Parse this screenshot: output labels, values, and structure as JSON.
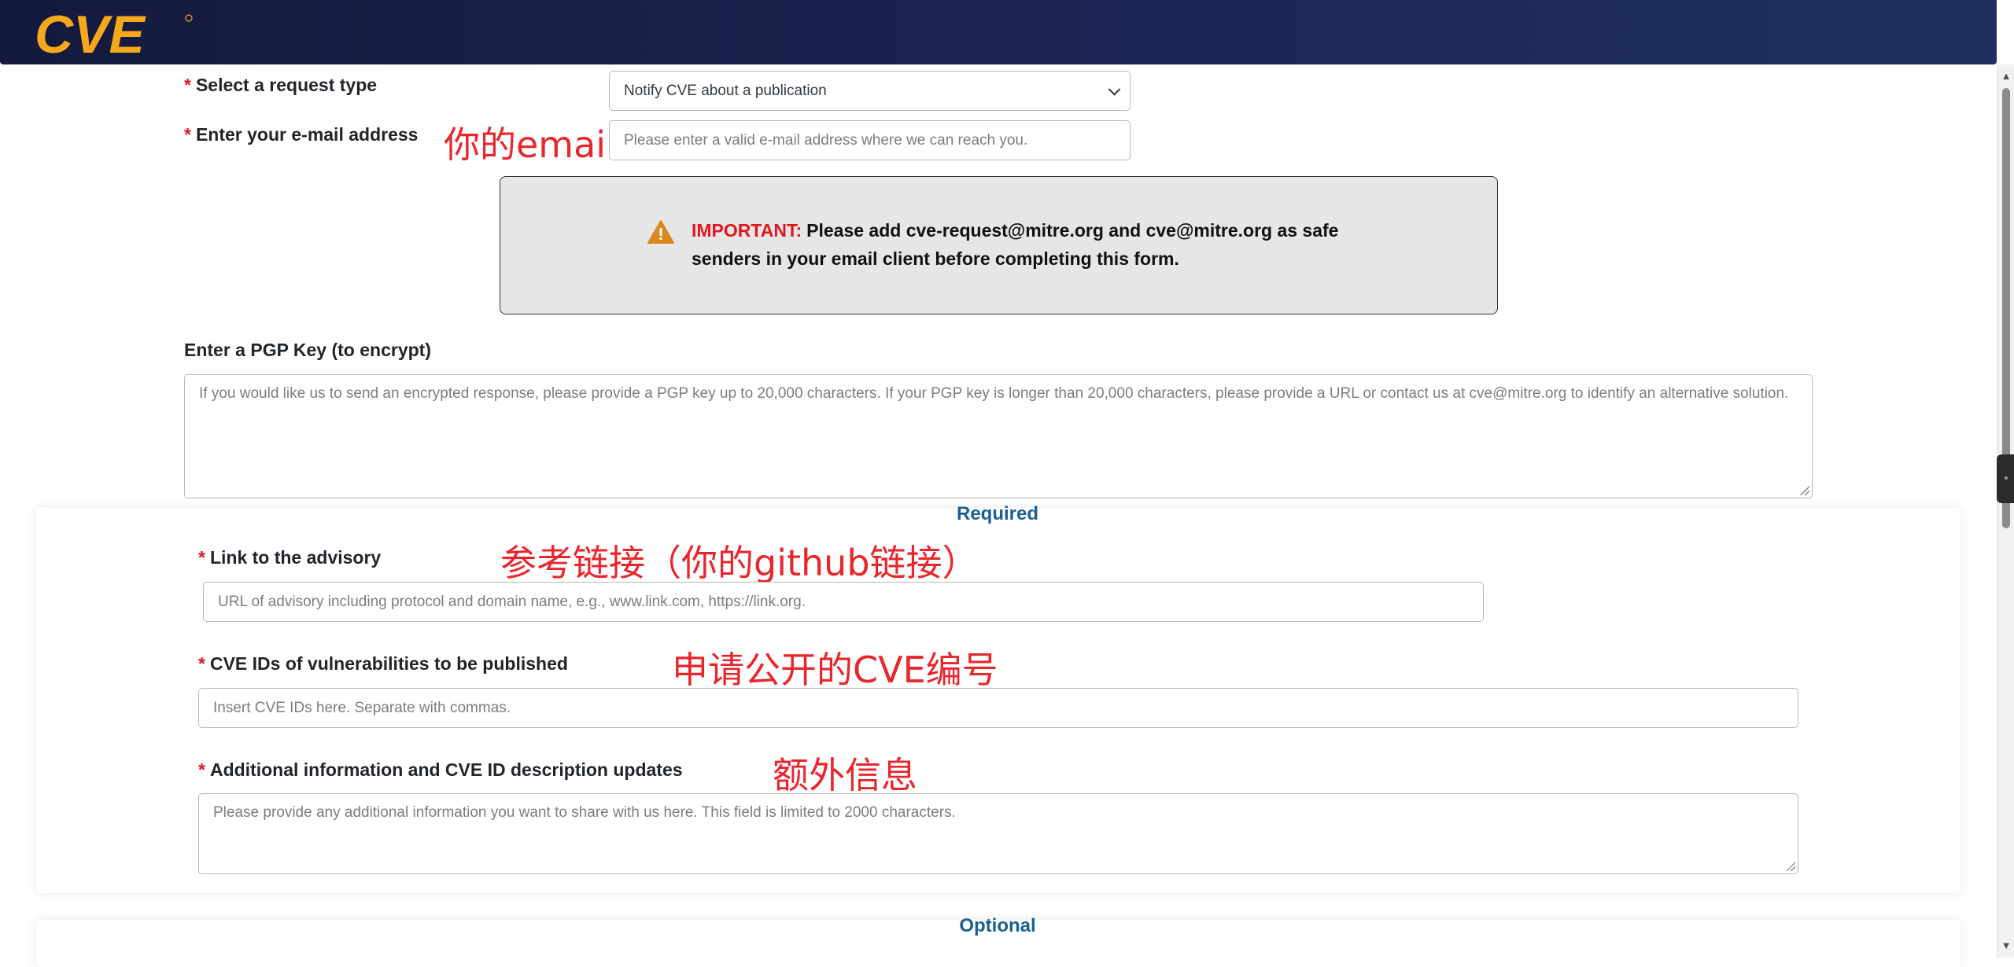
{
  "header": {
    "logo_text": "CVE"
  },
  "form": {
    "request_type": {
      "label": "Select a request type",
      "value": "Notify CVE about a publication",
      "required_mark": "*"
    },
    "email": {
      "label": "Enter your e-mail address",
      "placeholder": "Please enter a valid e-mail address where we can reach you.",
      "required_mark": "*",
      "annotation": "你的email"
    },
    "important": {
      "prefix": "IMPORTANT:",
      "text": "Please add cve-request@mitre.org and cve@mitre.org as safe senders in your email client before completing this form."
    },
    "pgp": {
      "label": "Enter a PGP Key (to encrypt)",
      "placeholder": "If you would like us to send an encrypted response, please provide a PGP key up to 20,000 characters. If your PGP key is longer than 20,000 characters, please provide a URL or contact us at cve@mitre.org to identify an alternative solution."
    },
    "required_section": {
      "heading": "Required",
      "advisory": {
        "label": "Link to the advisory",
        "required_mark": "*",
        "placeholder": "URL of advisory including protocol and domain name, e.g., www.link.com, https://link.org.",
        "annotation": "参考链接（你的github链接）"
      },
      "cve_ids": {
        "label": "CVE IDs of vulnerabilities to be published",
        "required_mark": "*",
        "placeholder": "Insert CVE IDs here. Separate with commas.",
        "annotation": "申请公开的CVE编号"
      },
      "additional": {
        "label": "Additional information and CVE ID description updates",
        "required_mark": "*",
        "placeholder": "Please provide any additional information you want to share with us here. This field is limited to 2000 characters.",
        "annotation": "额外信息"
      }
    },
    "optional_section": {
      "heading": "Optional"
    }
  },
  "colors": {
    "header_bg": "#1c2553",
    "logo": "#f5a81c",
    "required_star": "#e0161e",
    "annotation": "#e8262c",
    "section_heading": "#1a6090",
    "important_bg": "#e6e6e6"
  },
  "icons": {
    "warning": "warning-triangle-icon",
    "scroll_up": "scroll-up-arrow-icon",
    "scroll_down": "scroll-down-arrow-icon",
    "dropdown": "chevron-down-icon"
  }
}
